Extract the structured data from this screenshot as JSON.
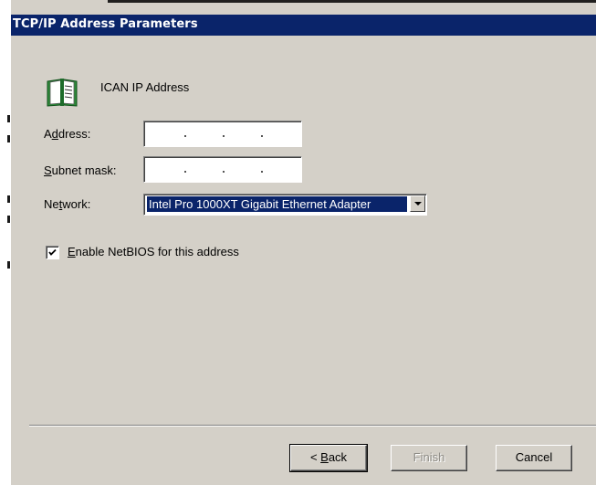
{
  "dialog": {
    "title": "TCP/IP Address Parameters"
  },
  "connection": {
    "icon": "book-icon",
    "title": "ICAN IP Address"
  },
  "fields": {
    "address_label": {
      "before": "A",
      "underline": "d",
      "after": "dress:"
    },
    "address_value": ". . .",
    "subnet_label": {
      "before": "",
      "underline": "S",
      "after": "ubnet mask:"
    },
    "subnet_value": ". . .",
    "network_label": {
      "before": "Ne",
      "underline": "t",
      "after": "work:"
    },
    "network_selected": "Intel Pro 1000XT Gigabit Ethernet Adapter"
  },
  "netbios": {
    "checked": true,
    "label": {
      "before": "",
      "underline": "E",
      "after": "nable NetBIOS for this address"
    }
  },
  "buttons": {
    "back": {
      "before": "< ",
      "underline": "B",
      "after": "ack"
    },
    "finish": "Finish",
    "cancel": "Cancel"
  },
  "colors": {
    "titlebar": "#0a246a",
    "face": "#d4d0c8",
    "selection": "#0a246a"
  }
}
